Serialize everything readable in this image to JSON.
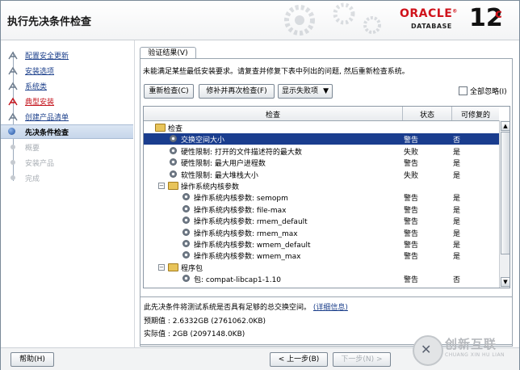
{
  "window": {
    "title": "执行先决条件检查"
  },
  "brand": {
    "oracle": "ORACLE",
    "database": "DATABASE",
    "version": "12",
    "version_suffix": "c"
  },
  "steps": [
    {
      "label": "配置安全更新",
      "state": "done"
    },
    {
      "label": "安装选项",
      "state": "done"
    },
    {
      "label": "系统类",
      "state": "done"
    },
    {
      "label": "典型安装",
      "state": "warn"
    },
    {
      "label": "创建产品清单",
      "state": "done"
    },
    {
      "label": "先决条件检查",
      "state": "active"
    },
    {
      "label": "概要",
      "state": "pending"
    },
    {
      "label": "安装产品",
      "state": "pending"
    },
    {
      "label": "完成",
      "state": "pending"
    }
  ],
  "tab": {
    "label": "验证结果(V)"
  },
  "message": "未能满足某些最低安装要求。请复查并修复下表中列出的问题, 然后重新检查系统。",
  "toolbar": {
    "recheck": "重新检查(C)",
    "fix_recheck": "修补并再次检查(F)",
    "show_failed": "显示失败项",
    "ignore_all": "全部忽略(I)"
  },
  "table": {
    "headers": {
      "check": "检查",
      "status": "状态",
      "fixable": "可修复的"
    },
    "rows": [
      {
        "label": "检查",
        "status": "",
        "fixable": "",
        "level": 0,
        "kind": "folder"
      },
      {
        "label": "交换空间大小",
        "status": "警告",
        "fixable": "否",
        "level": 1,
        "kind": "item",
        "selected": true
      },
      {
        "label": "硬性限制: 打开的文件描述符的最大数",
        "status": "失败",
        "fixable": "是",
        "level": 1,
        "kind": "item"
      },
      {
        "label": "硬性限制: 最大用户进程数",
        "status": "警告",
        "fixable": "是",
        "level": 1,
        "kind": "item"
      },
      {
        "label": "软性限制: 最大堆栈大小",
        "status": "失败",
        "fixable": "是",
        "level": 1,
        "kind": "item"
      },
      {
        "label": "操作系统内核参数",
        "status": "",
        "fixable": "",
        "level": 1,
        "kind": "folder"
      },
      {
        "label": "操作系统内核参数: semopm",
        "status": "警告",
        "fixable": "是",
        "level": 2,
        "kind": "item"
      },
      {
        "label": "操作系统内核参数: file-max",
        "status": "警告",
        "fixable": "是",
        "level": 2,
        "kind": "item"
      },
      {
        "label": "操作系统内核参数: rmem_default",
        "status": "警告",
        "fixable": "是",
        "level": 2,
        "kind": "item"
      },
      {
        "label": "操作系统内核参数: rmem_max",
        "status": "警告",
        "fixable": "是",
        "level": 2,
        "kind": "item"
      },
      {
        "label": "操作系统内核参数: wmem_default",
        "status": "警告",
        "fixable": "是",
        "level": 2,
        "kind": "item"
      },
      {
        "label": "操作系统内核参数: wmem_max",
        "status": "警告",
        "fixable": "是",
        "level": 2,
        "kind": "item"
      },
      {
        "label": "程序包",
        "status": "",
        "fixable": "",
        "level": 1,
        "kind": "folder"
      },
      {
        "label": "包: compat-libcap1-1.10",
        "status": "警告",
        "fixable": "否",
        "level": 2,
        "kind": "item"
      }
    ]
  },
  "details": {
    "description": "此先决条件将测试系统是否具有足够的总交换空间。",
    "more_link": "(详细信息)",
    "expected": "预期值 : 2.6332GB (2761062.0KB)",
    "actual": "实际值 : 2GB (2097148.0KB)"
  },
  "footer": {
    "help": "帮助(H)",
    "back": "< 上一步(B)",
    "next": "下一步(N) >"
  },
  "watermark": {
    "cn": "创新互联",
    "en": "CHUANG XIN HU LIAN"
  }
}
